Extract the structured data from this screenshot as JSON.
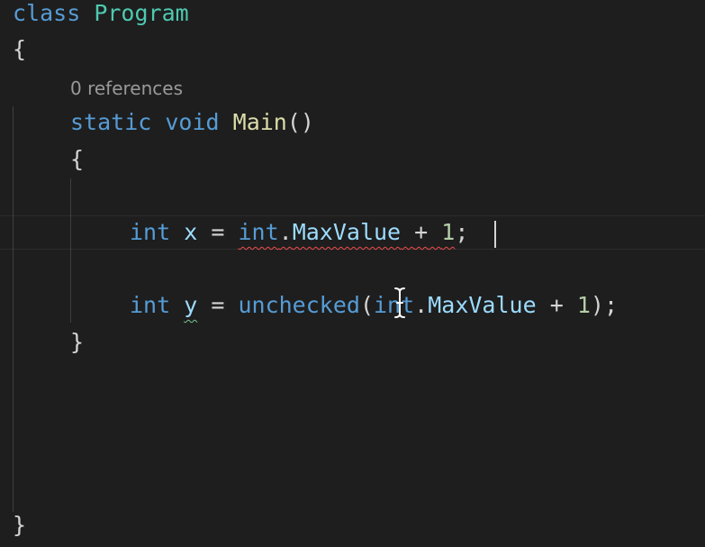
{
  "editor": {
    "code": {
      "class_keyword": "class",
      "class_name": "Program",
      "open_brace_outer": "{",
      "codelens": "0 references",
      "static_keyword": "static",
      "void_keyword": "void",
      "method_name": "Main",
      "method_parens": "()",
      "open_brace_inner": "{",
      "line_x": {
        "type": "int",
        "var": "x",
        "eq": "=",
        "expr_type": "int",
        "dot": ".",
        "member": "MaxValue",
        "plus": "+",
        "num": "1",
        "semi": ";"
      },
      "line_y": {
        "type": "int",
        "var": "y",
        "eq": "=",
        "keyword": "unchecked",
        "open_paren": "(",
        "expr_type": "int",
        "dot": ".",
        "member": "MaxValue",
        "plus": "+",
        "num": "1",
        "close": ");"
      },
      "close_brace_inner": "}",
      "close_brace_outer": "}"
    },
    "colors": {
      "background": "#1e1e1e",
      "keyword": "#569cd6",
      "type_name": "#4ec9b0",
      "method": "#dcdcaa",
      "identifier": "#9cdcfe",
      "number": "#b5cea8",
      "error_squiggle": "#f14c4c",
      "warning_squiggle": "#73c991",
      "codelens": "#999999"
    },
    "icons": {
      "cursor": "i-beam-cursor-icon"
    }
  }
}
